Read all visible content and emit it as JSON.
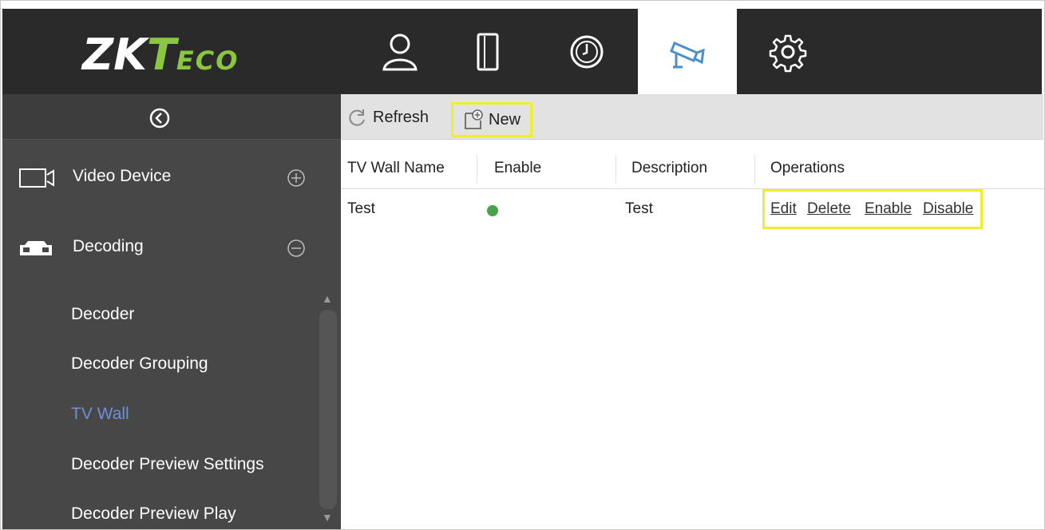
{
  "brand": {
    "logo_main": "ZK",
    "logo_t": "T",
    "logo_suffix": "ECO"
  },
  "topnav": {
    "items": [
      {
        "icon": "person-icon"
      },
      {
        "icon": "door-icon"
      },
      {
        "icon": "clock-icon"
      },
      {
        "icon": "camera-icon",
        "active": true
      },
      {
        "icon": "gear-icon"
      }
    ]
  },
  "sidebar": {
    "collapse_icon": "chevron-left-circle-icon",
    "groups": [
      {
        "label": "Video Device",
        "icon": "video-camera-icon",
        "expanded": false
      },
      {
        "label": "Decoding",
        "icon": "decoder-box-icon",
        "expanded": true
      }
    ],
    "sub_items": [
      {
        "label": "Decoder"
      },
      {
        "label": "Decoder Grouping"
      },
      {
        "label": "TV Wall",
        "active": true
      },
      {
        "label": "Decoder Preview Settings"
      },
      {
        "label": "Decoder Preview Play"
      }
    ]
  },
  "toolbar": {
    "refresh_label": "Refresh",
    "new_label": "New"
  },
  "table": {
    "columns": [
      "TV Wall Name",
      "Enable",
      "Description",
      "Operations"
    ],
    "rows": [
      {
        "name": "Test",
        "enabled": true,
        "description": "Test",
        "operations": [
          "Edit",
          "Delete",
          "Enable",
          "Disable"
        ]
      }
    ]
  },
  "colors": {
    "topbar": "#2a2a2a",
    "sidebar": "#474747",
    "highlight": "#f0ed2a",
    "active_item": "#6f8fd6",
    "enabled_dot": "#47a447",
    "brand_green": "#8bc63f"
  }
}
